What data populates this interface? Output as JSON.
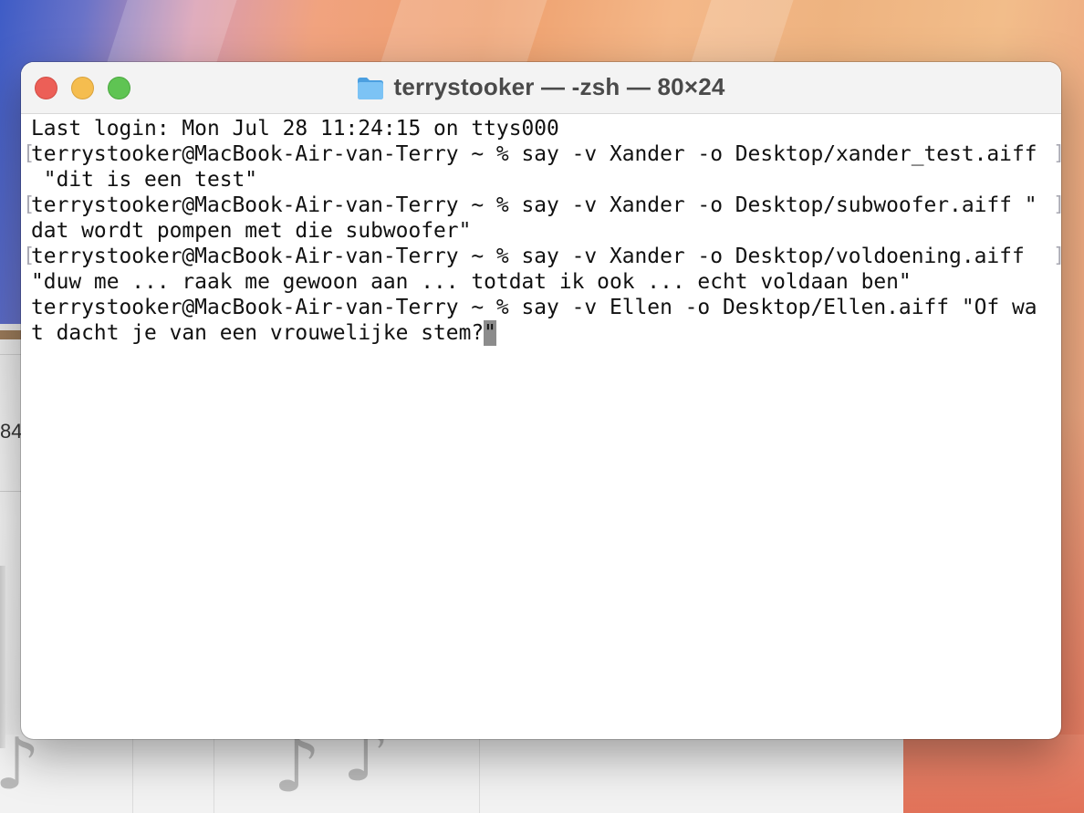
{
  "window": {
    "title": "terrystooker — -zsh — 80×24"
  },
  "background": {
    "partial_number": "84"
  },
  "terminal": {
    "lines": [
      {
        "text": "Last login: Mon Jul 28 11:24:15 on ttys000",
        "mark_left": "",
        "mark_right": ""
      },
      {
        "text": "terrystooker@MacBook-Air-van-Terry ~ % say -v Xander -o Desktop/xander_test.aiff",
        "mark_left": "[",
        "mark_right": "]"
      },
      {
        "text": " \"dit is een test\"",
        "mark_left": "",
        "mark_right": ""
      },
      {
        "text": "terrystooker@MacBook-Air-van-Terry ~ % say -v Xander -o Desktop/subwoofer.aiff \"",
        "mark_left": "[",
        "mark_right": "]"
      },
      {
        "text": "dat wordt pompen met die subwoofer\"",
        "mark_left": "",
        "mark_right": ""
      },
      {
        "text": "terrystooker@MacBook-Air-van-Terry ~ % say -v Xander -o Desktop/voldoening.aiff ",
        "mark_left": "[",
        "mark_right": "]"
      },
      {
        "text": "\"duw me ... raak me gewoon aan ... totdat ik ook ... echt voldaan ben\"",
        "mark_left": "",
        "mark_right": ""
      },
      {
        "text": "terrystooker@MacBook-Air-van-Terry ~ % say -v Ellen -o Desktop/Ellen.aiff \"Of wa",
        "mark_left": "",
        "mark_right": ""
      },
      {
        "text": "t dacht je van een vrouwelijke stem?",
        "mark_left": "",
        "mark_right": ""
      }
    ],
    "cursor_char": "\""
  },
  "colors": {
    "close": "#ec5f57",
    "minimize": "#f5bd4f",
    "zoom": "#5fc453",
    "folder": "#63b4ef"
  },
  "icons": {
    "title": "folder-icon",
    "background": "music-note-icon"
  }
}
